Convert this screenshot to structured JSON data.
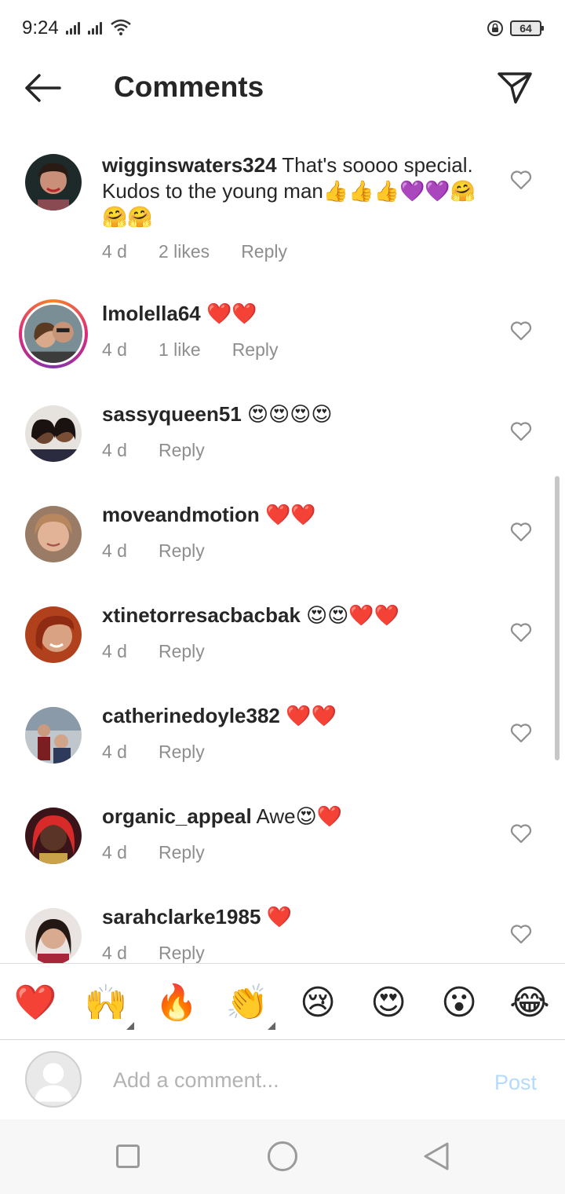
{
  "status_bar": {
    "time": "9:24",
    "battery": "64"
  },
  "header": {
    "title": "Comments"
  },
  "comments": [
    {
      "user": "wigginswaters324",
      "text": " That's soooo special.  Kudos to the young man👍👍👍💜💜🤗🤗🤗",
      "age": "4 d",
      "likes": "2 likes",
      "reply": "Reply"
    },
    {
      "user": "lmolella64",
      "text": " ❤️❤️",
      "age": "4 d",
      "likes": "1 like",
      "reply": "Reply"
    },
    {
      "user": "sassyqueen51",
      "text": " 😍😍😍😍",
      "age": "4 d",
      "reply": "Reply"
    },
    {
      "user": "moveandmotion",
      "text": " ❤️❤️",
      "age": "4 d",
      "reply": "Reply"
    },
    {
      "user": "xtinetorresacbacbak",
      "text": " 😍😍❤️❤️",
      "age": "4 d",
      "reply": "Reply"
    },
    {
      "user": "catherinedoyle382",
      "text": " ❤️❤️",
      "age": "4 d",
      "reply": "Reply"
    },
    {
      "user": "organic_appeal",
      "text": " Awe😍❤️",
      "age": "4 d",
      "reply": "Reply"
    },
    {
      "user": "sarahclarke1985",
      "text": " ❤️",
      "age": "4 d",
      "reply": "Reply"
    }
  ],
  "quick_reactions": [
    "❤️",
    "🙌",
    "🔥",
    "👏",
    "😢",
    "😍",
    "😮",
    "😂"
  ],
  "composer": {
    "placeholder": "Add a comment...",
    "post_label": "Post"
  },
  "colors": {
    "accent_disabled": "#b3dbff",
    "secondary_text": "#8e8e8e",
    "heart_red": "#e0161e"
  }
}
